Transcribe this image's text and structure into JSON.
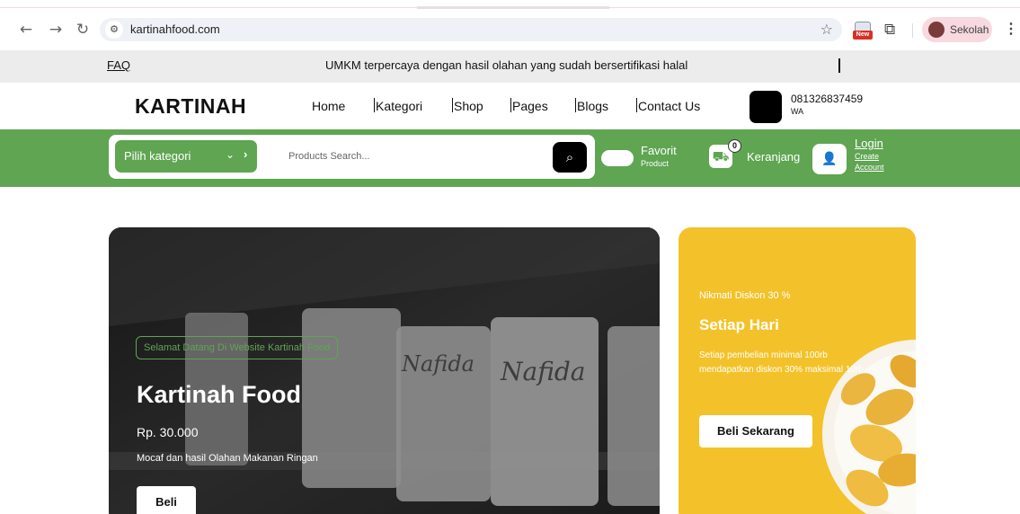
{
  "browser": {
    "url": "kartinahfood.com",
    "extension_badge": "New",
    "profile_name": "Sekolah"
  },
  "topbar": {
    "faq": "FAQ",
    "promo_text": "UMKM terpercaya dengan hasil olahan yang sudah bersertifikasi halal"
  },
  "header": {
    "logo": "KARTINAH",
    "nav": [
      "Home",
      "Kategori",
      "Shop",
      "Pages",
      "Blogs",
      "Contact Us"
    ],
    "phone": "081326837459",
    "phone_label": "WA"
  },
  "searchbar": {
    "category_label": "Pilih kategori",
    "search_placeholder": "Products Search...",
    "favorit": "Favorit",
    "favorit_sub": "Product",
    "cart_count": "0",
    "cart_label": "Keranjang",
    "login": "Login",
    "create_1": "Create",
    "create_2": "Account"
  },
  "hero": {
    "welcome": "Selamat Datang Di Website Kartinah Food",
    "title": "Kartinah Food",
    "price": "Rp. 30.000",
    "description": "Mocaf dan hasil Olahan Makanan Ringan",
    "button": "Beli"
  },
  "promo_card": {
    "discount": "Nikmati Diskon 30 %",
    "headline": "Setiap Hari",
    "description": "Setiap pembelian minimal 100rb mendapatkan diskon 30% maksimal 10rb",
    "button": "Beli Sekarang"
  },
  "colors": {
    "brand_green": "#5fa552",
    "promo_yellow": "#f3c22a"
  }
}
